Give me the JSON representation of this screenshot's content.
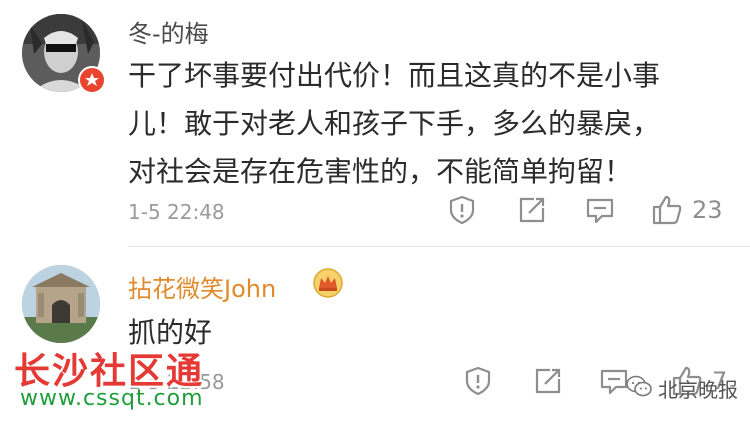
{
  "comments": [
    {
      "username": "冬-的梅",
      "lines": [
        "干了坏事要付出代价！而且这真的不是小事",
        "儿！敢于对老人和孩子下手，多么的暴戾，",
        "对社会是存在危害性的，不能简单拘留！"
      ],
      "time": "1-5 22:48",
      "like_count": "23"
    },
    {
      "username": "拈花微笑John",
      "lines": [
        "抓的好"
      ],
      "time": "1-5 22:58",
      "like_count": "7"
    }
  ],
  "watermark": {
    "text": "长沙社区通",
    "url": "www.cssqt.com"
  },
  "source": {
    "label": "北京晚报"
  },
  "icons": {
    "report": "report-icon",
    "share": "share-icon",
    "reply": "reply-icon",
    "like": "thumbs-up-icon",
    "verified": "verified-badge-icon",
    "crown": "crown-icon",
    "wechat": "wechat-icon"
  },
  "colors": {
    "gold_username": "#e08a2c",
    "watermark_red": "#e53935",
    "watermark_green": "#1f9e3b",
    "badge_red": "#e8442e"
  }
}
